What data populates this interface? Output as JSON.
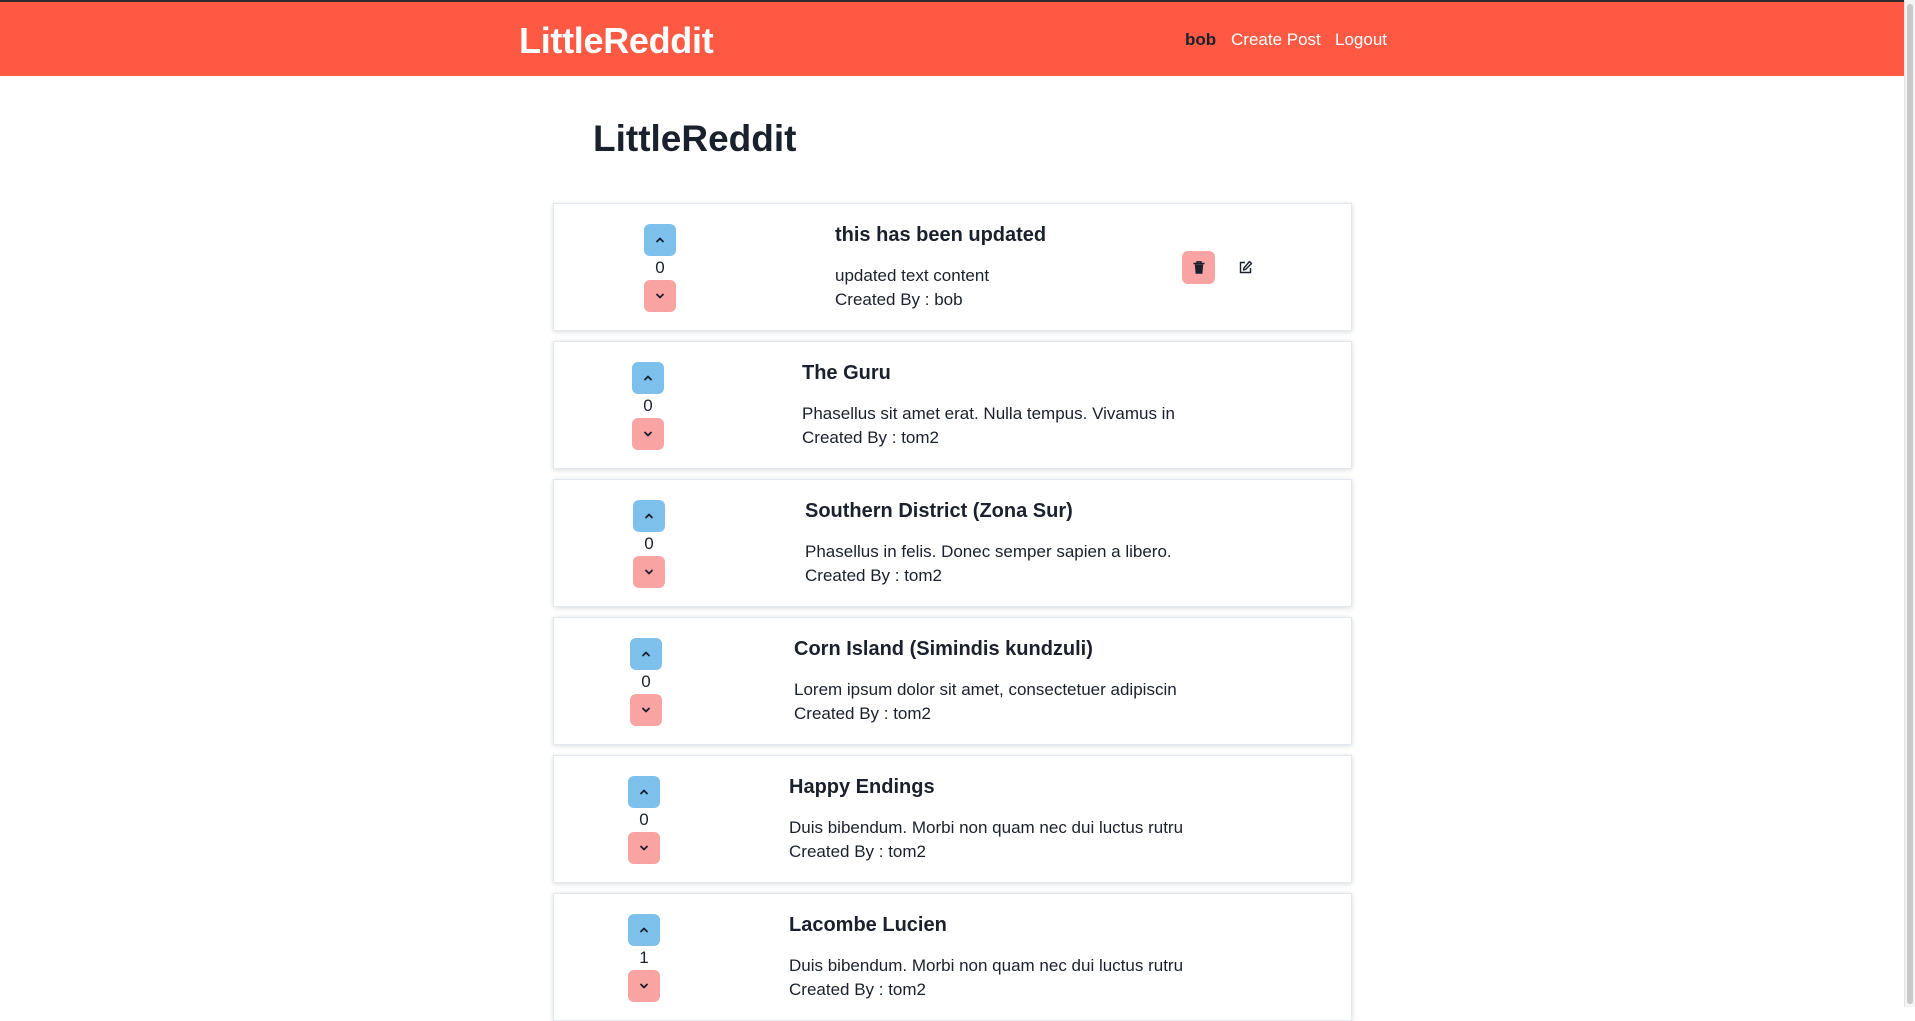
{
  "colors": {
    "accent": "#ff5943",
    "upvote": "#7ec0ec",
    "downvote": "#f9a3a3"
  },
  "navbar": {
    "brand": "LittleReddit",
    "user": "bob",
    "create_post": "Create Post",
    "logout": "Logout"
  },
  "page": {
    "title": "LittleReddit"
  },
  "posts": [
    {
      "title": "this has been updated",
      "text": "updated text content",
      "created_by": "Created By : bob",
      "votes": "0",
      "owned": true
    },
    {
      "title": "The Guru",
      "text": "Phasellus sit amet erat. Nulla tempus. Vivamus in",
      "created_by": "Created By : tom2",
      "votes": "0"
    },
    {
      "title": "Southern District (Zona Sur)",
      "text": "Phasellus in felis. Donec semper sapien a libero.",
      "created_by": "Created By : tom2",
      "votes": "0"
    },
    {
      "title": "Corn Island (Simindis kundzuli)",
      "text": "Lorem ipsum dolor sit amet, consectetuer adipiscin",
      "created_by": "Created By : tom2",
      "votes": "0"
    },
    {
      "title": "Happy Endings",
      "text": "Duis bibendum. Morbi non quam nec dui luctus rutru",
      "created_by": "Created By : tom2",
      "votes": "0"
    },
    {
      "title": "Lacombe Lucien",
      "text": "Duis bibendum. Morbi non quam nec dui luctus rutru",
      "created_by": "Created By : tom2",
      "votes": "1"
    }
  ],
  "icons": {
    "upvote": "chevron-up-icon",
    "downvote": "chevron-down-icon",
    "delete": "trash-icon",
    "edit": "edit-icon"
  }
}
